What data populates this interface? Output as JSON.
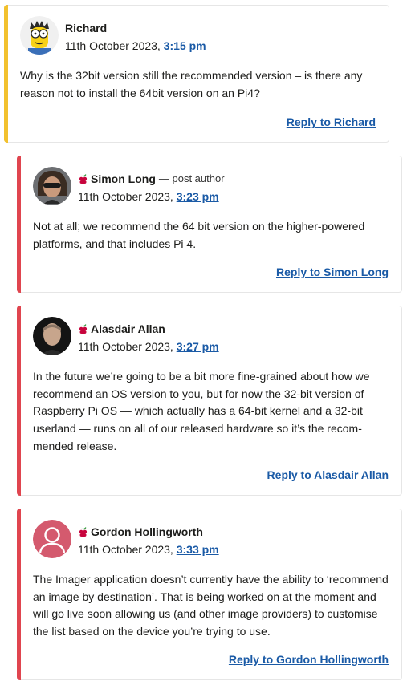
{
  "comments": [
    {
      "name": "Richard",
      "is_author": false,
      "date": "11th October 2023,",
      "time": "3:15 pm",
      "body": "Why is the 32bit version still the recommended version – is there any reason not to install the 64bit version on an Pi4?",
      "reply": "Reply to Richard",
      "accent": "#f2c12e"
    },
    {
      "name": "Simon Long",
      "author_tag": "— post author",
      "date": "11th October 2023,",
      "time": "3:23 pm",
      "body": "Not at all; we recommend the 64 bit version on the higher-powered platforms, and that includes Pi 4.",
      "reply": "Reply to Simon Long",
      "accent": "#e0454f"
    },
    {
      "name": "Alasdair Allan",
      "date": "11th October 2023,",
      "time": "3:27 pm",
      "body": "In the future we’re going to be a bit more fine-grained about how we recommend an OS version to you, but for now the 32-bit version of Raspberry Pi OS — which actually has a 64-bit kernel and a 32-bit userland — runs on all of our released hardware so it’s the recom­mended release.",
      "reply": "Reply to Alasdair Allan",
      "accent": "#e0454f"
    },
    {
      "name": "Gordon Hollingworth",
      "date": "11th October 2023,",
      "time": "3:33 pm",
      "body": "The Imager application doesn’t currently have the ability to ‘recom­mend an image by destination’. That is being worked on at the mo­ment and will go live soon allowing us (and other image providers) to customise the list based on the device you’re trying to use.",
      "reply": "Reply to Gordon Hollingworth",
      "accent": "#e0454f"
    }
  ]
}
